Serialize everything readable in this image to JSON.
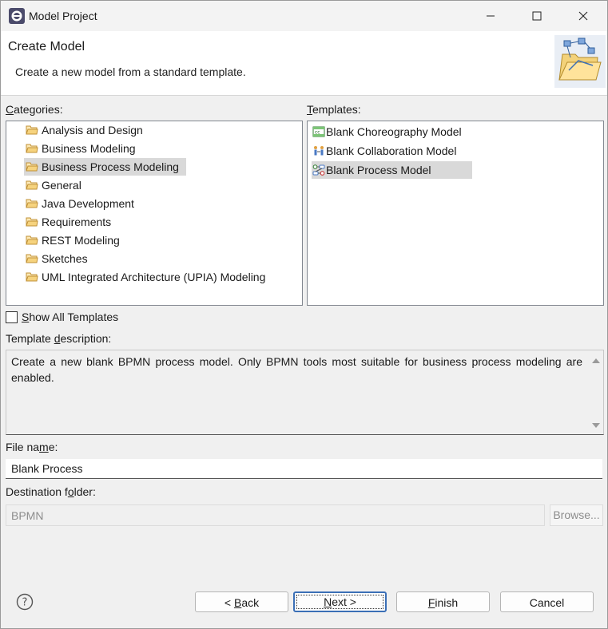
{
  "window": {
    "title": "Model Project",
    "icons": {
      "app": "eclipse-icon",
      "minimize": "minimize-icon",
      "maximize": "maximize-icon",
      "close": "close-icon"
    }
  },
  "header": {
    "title": "Create Model",
    "description": "Create a new model from a standard template.",
    "graphic_icon": "new-model-folder-icon"
  },
  "categories": {
    "label_prefix": "",
    "label_mnemonic": "C",
    "label_rest": "ategories:",
    "items": [
      {
        "label": "Analysis and Design",
        "icon": "folder-icon",
        "selected": false
      },
      {
        "label": "Business Modeling",
        "icon": "folder-icon",
        "selected": false
      },
      {
        "label": "Business Process Modeling",
        "icon": "folder-icon",
        "selected": true
      },
      {
        "label": "General",
        "icon": "folder-icon",
        "selected": false
      },
      {
        "label": "Java Development",
        "icon": "folder-icon",
        "selected": false
      },
      {
        "label": "Requirements",
        "icon": "folder-icon",
        "selected": false
      },
      {
        "label": "REST Modeling",
        "icon": "folder-icon",
        "selected": false
      },
      {
        "label": "Sketches",
        "icon": "folder-icon",
        "selected": false
      },
      {
        "label": "UML Integrated Architecture (UPIA) Modeling",
        "icon": "folder-icon",
        "selected": false
      }
    ]
  },
  "templates": {
    "label_mnemonic": "T",
    "label_rest": "emplates:",
    "items": [
      {
        "label": "Blank Choreography Model",
        "icon": "choreography-model-icon",
        "selected": false
      },
      {
        "label": "Blank Collaboration Model",
        "icon": "collaboration-model-icon",
        "selected": false
      },
      {
        "label": "Blank Process Model",
        "icon": "process-model-icon",
        "selected": true
      }
    ]
  },
  "show_all": {
    "mnemonic": "S",
    "rest": "how All Templates",
    "checked": false
  },
  "template_description": {
    "label_prefix": "Template ",
    "label_mnemonic": "d",
    "label_rest": "escription:",
    "text": "Create a new blank BPMN process model. Only BPMN tools most suitable for business process modeling are enabled."
  },
  "file_name": {
    "label_prefix": "File na",
    "label_mnemonic": "m",
    "label_rest": "e:",
    "value": "Blank Process"
  },
  "destination": {
    "label_prefix": "Destination f",
    "label_mnemonic": "o",
    "label_rest": "lder:",
    "value": "BPMN",
    "browse_label": "Browse..."
  },
  "footer": {
    "help_icon": "help-icon",
    "back": {
      "prefix": "< ",
      "mnemonic": "B",
      "rest": "ack"
    },
    "next": {
      "mnemonic": "N",
      "rest": "ext >"
    },
    "finish": {
      "mnemonic": "F",
      "rest": "inish"
    },
    "cancel": "Cancel"
  }
}
